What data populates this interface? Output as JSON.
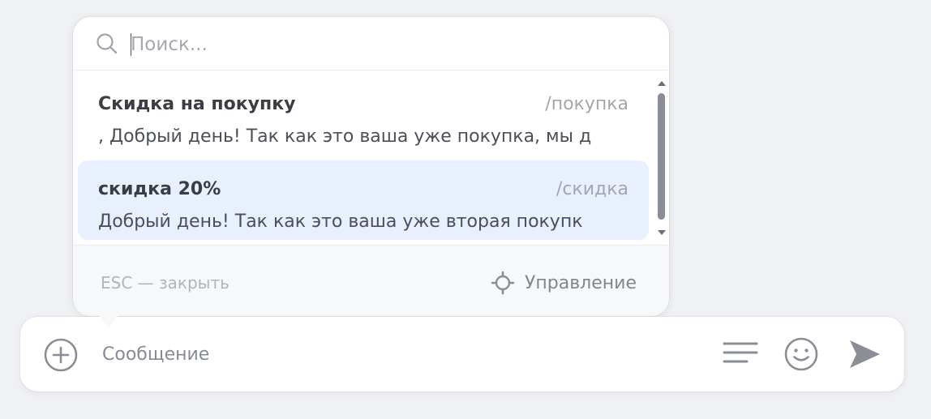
{
  "search": {
    "placeholder": "Поиск..."
  },
  "templates": [
    {
      "title": "Скидка на покупку",
      "command": "/покупка",
      "text": ", Добрый день! Так как это ваша уже покупка, мы д",
      "selected": false
    },
    {
      "title": "скидка 20%",
      "command": "/скидка",
      "text": "Добрый день! Так как это ваша уже вторая покупк",
      "selected": true
    }
  ],
  "footer": {
    "esc_hint": "ESC — закрыть",
    "manage_label": "Управление"
  },
  "composer": {
    "placeholder": "Сообщение"
  },
  "icons": {
    "search": "search-icon",
    "manage": "crosshair-settings-icon",
    "attach": "plus-circle-icon",
    "templates": "lines-icon",
    "emoji": "smile-icon",
    "send": "send-arrow-icon"
  },
  "colors": {
    "selected_row": "#e8effd",
    "icon_gray": "#8a8e96",
    "background": "#f0f1f4"
  }
}
